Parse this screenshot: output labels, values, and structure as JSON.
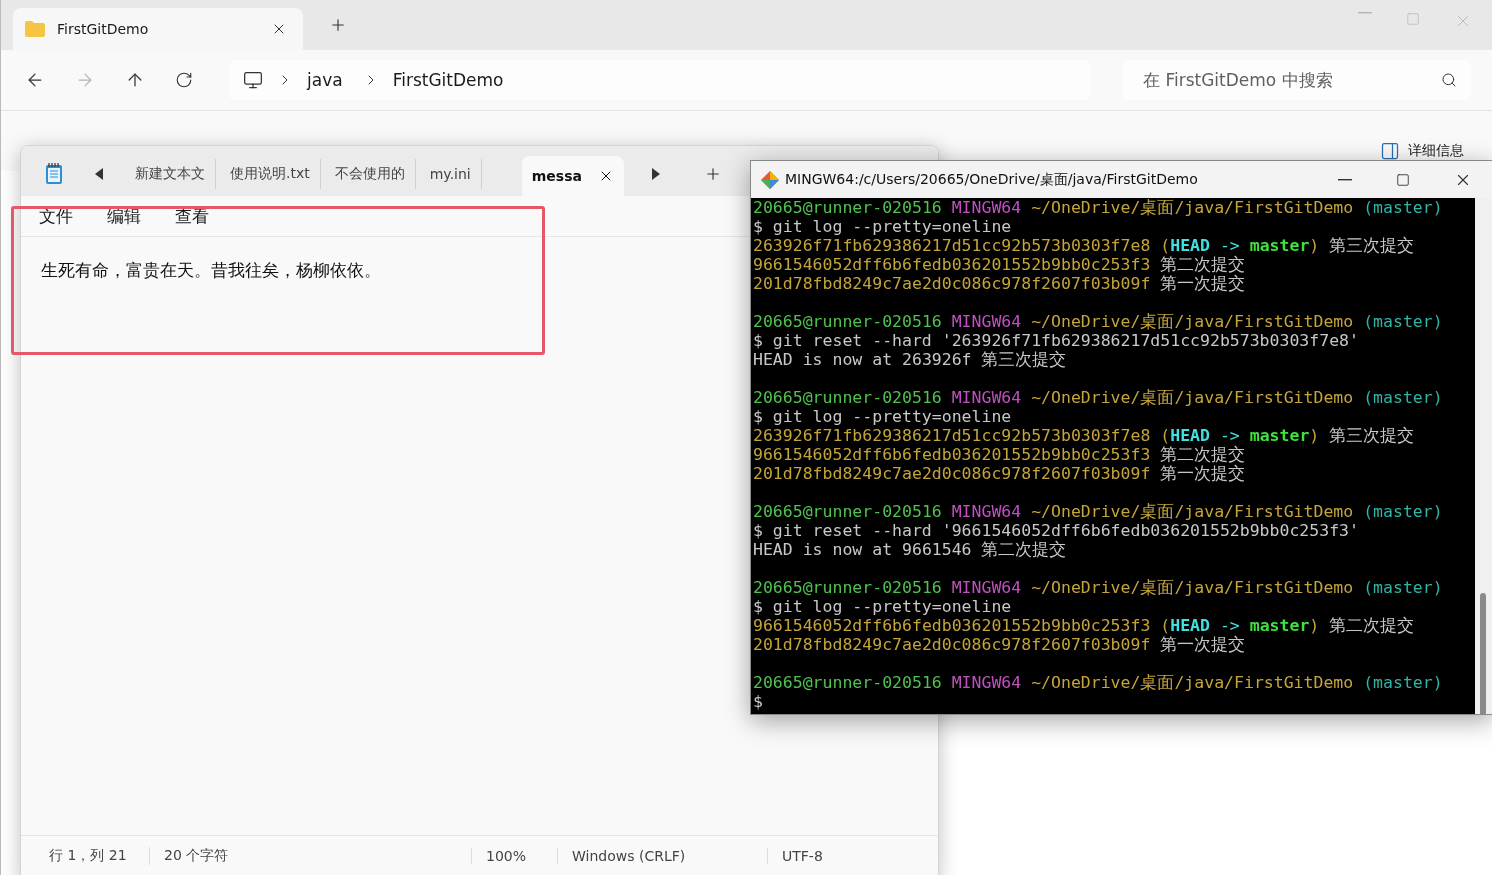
{
  "explorer": {
    "tab": {
      "title": "FirstGitDemo"
    },
    "nav": [
      {
        "kind": "back",
        "disabled": false
      },
      {
        "kind": "forward",
        "disabled": true
      },
      {
        "kind": "up",
        "disabled": false
      },
      {
        "kind": "refresh",
        "disabled": false
      }
    ],
    "breadcrumbs": [
      "java",
      "FirstGitDemo"
    ],
    "search": {
      "placeholder": "在 FirstGitDemo 中搜索"
    },
    "details_button": "详细信息"
  },
  "notepad": {
    "tabs": [
      {
        "label": "新建文本文",
        "selected": false
      },
      {
        "label": "使用说明.txt",
        "selected": false
      },
      {
        "label": "不会使用的",
        "selected": false
      },
      {
        "label": "my.ini",
        "selected": false
      },
      {
        "label": "messa",
        "selected": true
      }
    ],
    "menu": [
      "文件",
      "编辑",
      "查看"
    ],
    "content": "生死有命，富贵在天。昔我往矣，杨柳依依。",
    "status": [
      "行 1，列 21",
      "20 个字符",
      "100%",
      "Windows (CRLF)",
      "UTF-8"
    ]
  },
  "terminal": {
    "title": "MINGW64:/c/Users/20665/OneDrive/桌面/java/FirstGitDemo",
    "lines": [
      {
        "kind": "prompt",
        "user": "20665@runner-020516",
        "host": "MINGW64",
        "path": "~/OneDrive/桌面/java/FirstGitDemo",
        "branch": "(master)"
      },
      {
        "kind": "command",
        "symbol": "$",
        "text": "git log --pretty=oneline"
      },
      {
        "kind": "log",
        "hash": "263926f71fb629386217d51cc92b573b0303f7e8",
        "refs": {
          "open": "(",
          "head": "HEAD",
          "arrow": "->",
          "branch": "master",
          "close": ")"
        },
        "message": "第三次提交"
      },
      {
        "kind": "log",
        "hash": "9661546052dff6b6fedb036201552b9bb0c253f3",
        "message": "第二次提交"
      },
      {
        "kind": "log",
        "hash": "201d78fbd8249c7ae2d0c086c978f2607f03b09f",
        "message": "第一次提交"
      },
      {
        "kind": "blank"
      },
      {
        "kind": "prompt",
        "user": "20665@runner-020516",
        "host": "MINGW64",
        "path": "~/OneDrive/桌面/java/FirstGitDemo",
        "branch": "(master)"
      },
      {
        "kind": "command",
        "symbol": "$",
        "text": "git reset --hard '263926f71fb629386217d51cc92b573b0303f7e8'"
      },
      {
        "kind": "output",
        "text": "HEAD is now at 263926f 第三次提交"
      },
      {
        "kind": "blank"
      },
      {
        "kind": "prompt",
        "user": "20665@runner-020516",
        "host": "MINGW64",
        "path": "~/OneDrive/桌面/java/FirstGitDemo",
        "branch": "(master)"
      },
      {
        "kind": "command",
        "symbol": "$",
        "text": "git log --pretty=oneline"
      },
      {
        "kind": "log",
        "hash": "263926f71fb629386217d51cc92b573b0303f7e8",
        "refs": {
          "open": "(",
          "head": "HEAD",
          "arrow": "->",
          "branch": "master",
          "close": ")"
        },
        "message": "第三次提交"
      },
      {
        "kind": "log",
        "hash": "9661546052dff6b6fedb036201552b9bb0c253f3",
        "message": "第二次提交"
      },
      {
        "kind": "log",
        "hash": "201d78fbd8249c7ae2d0c086c978f2607f03b09f",
        "message": "第一次提交"
      },
      {
        "kind": "blank"
      },
      {
        "kind": "prompt",
        "user": "20665@runner-020516",
        "host": "MINGW64",
        "path": "~/OneDrive/桌面/java/FirstGitDemo",
        "branch": "(master)"
      },
      {
        "kind": "command",
        "symbol": "$",
        "text": "git reset --hard '9661546052dff6b6fedb036201552b9bb0c253f3'"
      },
      {
        "kind": "output",
        "text": "HEAD is now at 9661546 第二次提交"
      },
      {
        "kind": "blank"
      },
      {
        "kind": "prompt",
        "user": "20665@runner-020516",
        "host": "MINGW64",
        "path": "~/OneDrive/桌面/java/FirstGitDemo",
        "branch": "(master)"
      },
      {
        "kind": "command",
        "symbol": "$",
        "text": "git log --pretty=oneline"
      },
      {
        "kind": "log",
        "hash": "9661546052dff6b6fedb036201552b9bb0c253f3",
        "refs": {
          "open": "(",
          "head": "HEAD",
          "arrow": "->",
          "branch": "master",
          "close": ")"
        },
        "message": "第二次提交"
      },
      {
        "kind": "log",
        "hash": "201d78fbd8249c7ae2d0c086c978f2607f03b09f",
        "message": "第一次提交"
      },
      {
        "kind": "blank"
      },
      {
        "kind": "prompt",
        "user": "20665@runner-020516",
        "host": "MINGW64",
        "path": "~/OneDrive/桌面/java/FirstGitDemo",
        "branch": "(master)"
      },
      {
        "kind": "command",
        "symbol": "$"
      }
    ]
  }
}
